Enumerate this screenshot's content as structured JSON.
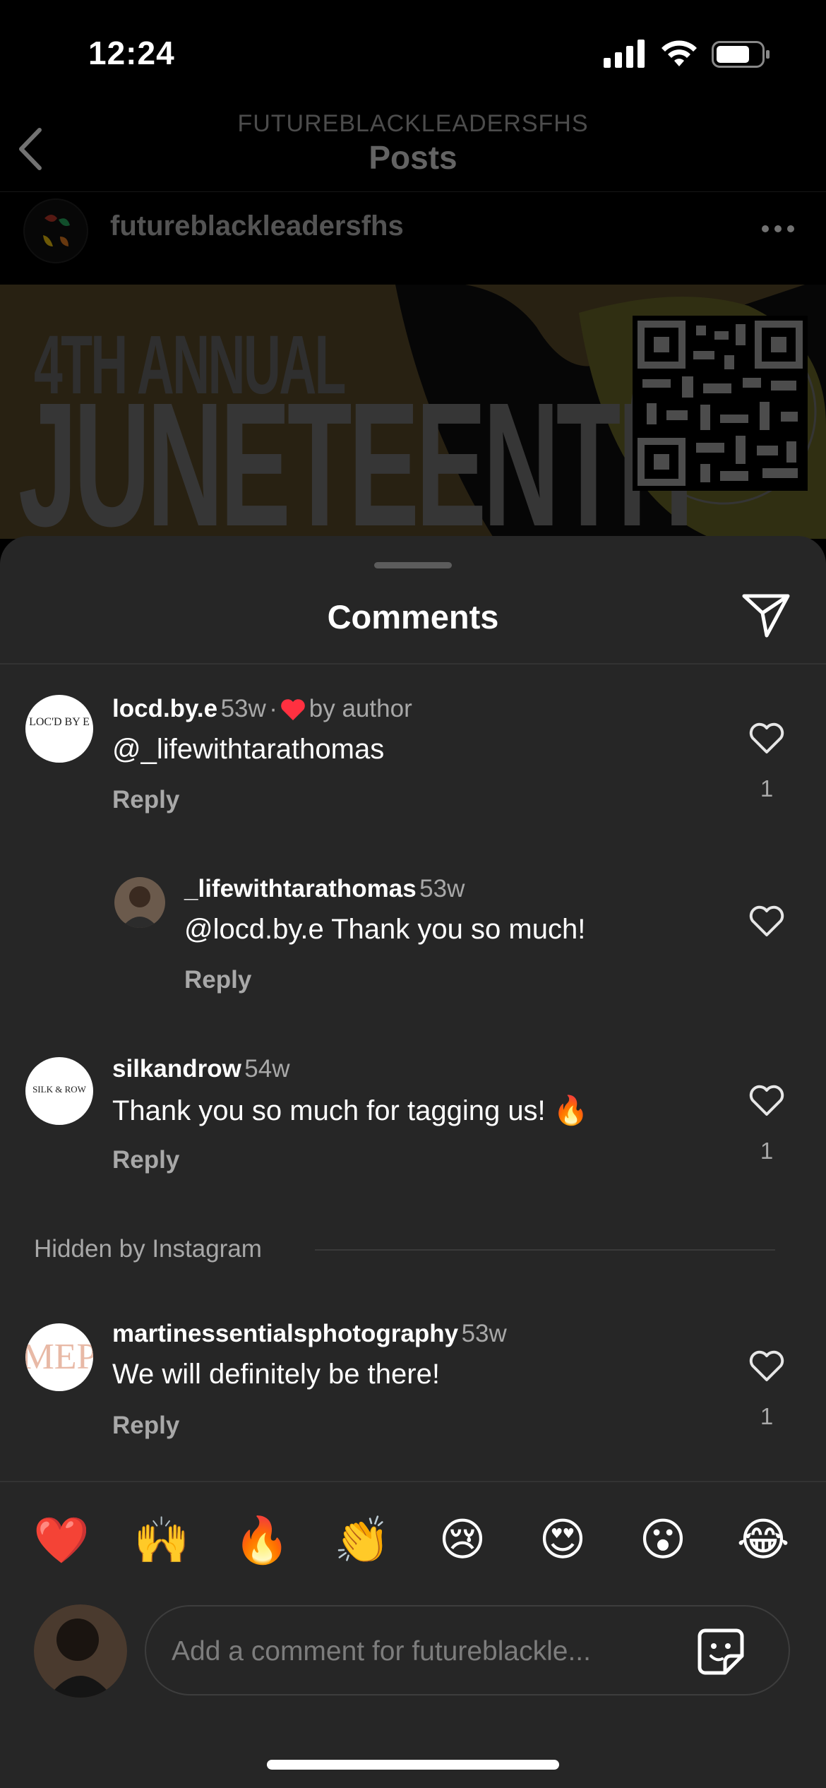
{
  "status_bar": {
    "time": "12:24"
  },
  "header": {
    "subtitle": "FUTUREBLACKLEADERSFHS",
    "title": "Posts"
  },
  "post": {
    "username": "futureblackleadersfhs",
    "image_text_line1": "4TH ANNUAL",
    "image_text_line2": "JUNETEENTH"
  },
  "sheet": {
    "title": "Comments"
  },
  "comments": [
    {
      "username": "locd.by.e",
      "age": "53w",
      "meta_sep": "·",
      "by_author": "by author",
      "text": "@_lifewithtarathomas",
      "reply": "Reply",
      "likes": "1",
      "avatar_text": "LOC'D BY E"
    },
    {
      "username": "_lifewithtarathomas",
      "age": "53w",
      "text": "@locd.by.e Thank you so much!",
      "reply": "Reply"
    },
    {
      "username": "silkandrow",
      "age": "54w",
      "text": "Thank you so much for tagging us! 🔥",
      "reply": "Reply",
      "likes": "1",
      "avatar_text": "SILK & ROW"
    },
    {
      "username": "martinessentialsphotography",
      "age": "53w",
      "text": "We will definitely be there!",
      "reply": "Reply",
      "likes": "1"
    }
  ],
  "hidden_label": "Hidden by Instagram",
  "emoji_bar": [
    "❤️",
    "🙌",
    "🔥",
    "👏",
    "😢",
    "😍",
    "😮",
    "😂"
  ],
  "composer": {
    "placeholder": "Add a comment for futureblackle..."
  },
  "colors": {
    "sheet_bg": "#262626",
    "heart_red": "#ff3040",
    "muted_text": "#a8a8a8"
  }
}
